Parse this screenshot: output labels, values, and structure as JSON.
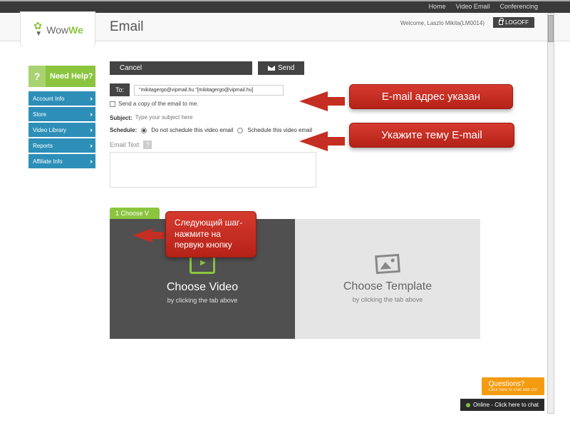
{
  "topnav": {
    "home": "Home",
    "video": "Video Email",
    "conf": "Conferencing"
  },
  "header": {
    "title": "Email",
    "welcome": "Welcome, Laszlo Mikita(LM0014)",
    "logoff": "LOGOFF"
  },
  "logo": {
    "brand_w": "Wow",
    "brand_we": "We"
  },
  "sidebar": {
    "help": "Need Help?",
    "help_q": "?",
    "items": [
      {
        "label": "Account Info"
      },
      {
        "label": "Store"
      },
      {
        "label": "Video Library"
      },
      {
        "label": "Reports"
      },
      {
        "label": "Affiliate Info"
      }
    ]
  },
  "toolbar": {
    "cancel": "Cancel",
    "send": "Send"
  },
  "compose": {
    "to_label": "To:",
    "to_value": "\"mikitagergo@vipmail.hu \"[mikitagergo@vipmail.hu]",
    "copy_label": "Send a copy of the email to me.",
    "subject_label": "Subject:",
    "subject_placeholder": "Type your subject here",
    "schedule_label": "Schedule:",
    "schedule_no": "Do not schedule this video email",
    "schedule_yes": "Schedule this video email",
    "emailtext": "Email Text",
    "q": "?"
  },
  "step": {
    "tab": "1 Choose V"
  },
  "panels": {
    "video": {
      "title": "Choose Video",
      "sub": "by clicking the tab above"
    },
    "template": {
      "title": "Choose Template",
      "sub": "by clicking the tab above"
    }
  },
  "callouts": {
    "c1": "E-mail адрес указан",
    "c2": "Укажите тему E-mail",
    "c3": "Следующий шаг- нажмите на первую кнопку"
  },
  "help": {
    "questions": "Questions?",
    "questions_sub": "Click here to chat with us!",
    "chat": "Online - Click here to chat"
  }
}
